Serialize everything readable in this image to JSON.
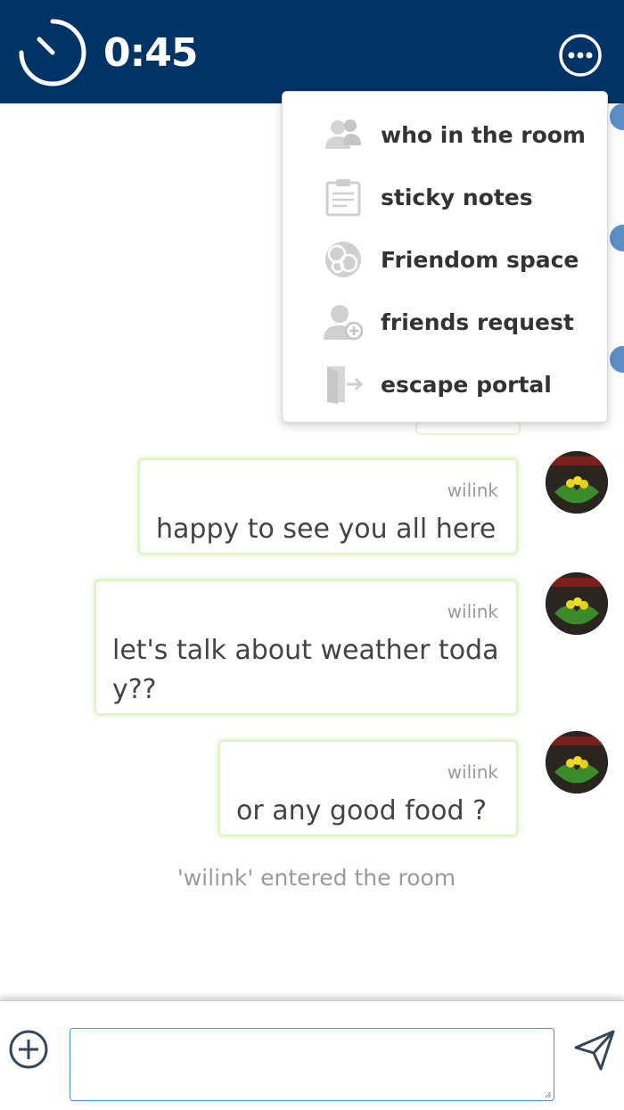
{
  "header": {
    "timer": "0:45",
    "timer_icon": "stopwatch-icon",
    "more_icon": "more-options-icon",
    "background_color": "#003366"
  },
  "menu": {
    "items": [
      {
        "label": "who in the room",
        "icon": "users-icon"
      },
      {
        "label": "sticky notes",
        "icon": "sticky-note-icon"
      },
      {
        "label": "Friendom space",
        "icon": "globe-icon"
      },
      {
        "label": "friends request",
        "icon": "add-friend-icon"
      },
      {
        "label": "escape portal",
        "icon": "exit-door-icon"
      }
    ]
  },
  "messages": [
    {
      "sender": "wilink",
      "text": "happy to see you all here"
    },
    {
      "sender": "wilink",
      "text": "let's talk about weather today??"
    },
    {
      "sender": "wilink",
      "text": "or any good food ?"
    }
  ],
  "system_message": "'wilink' entered the room",
  "composer": {
    "input_value": "",
    "attach_icon": "plus-circle-icon",
    "send_icon": "send-icon"
  },
  "colors": {
    "accent": "#003366",
    "bubble_border": "#c8e6a0",
    "input_border": "#4a90d9"
  }
}
